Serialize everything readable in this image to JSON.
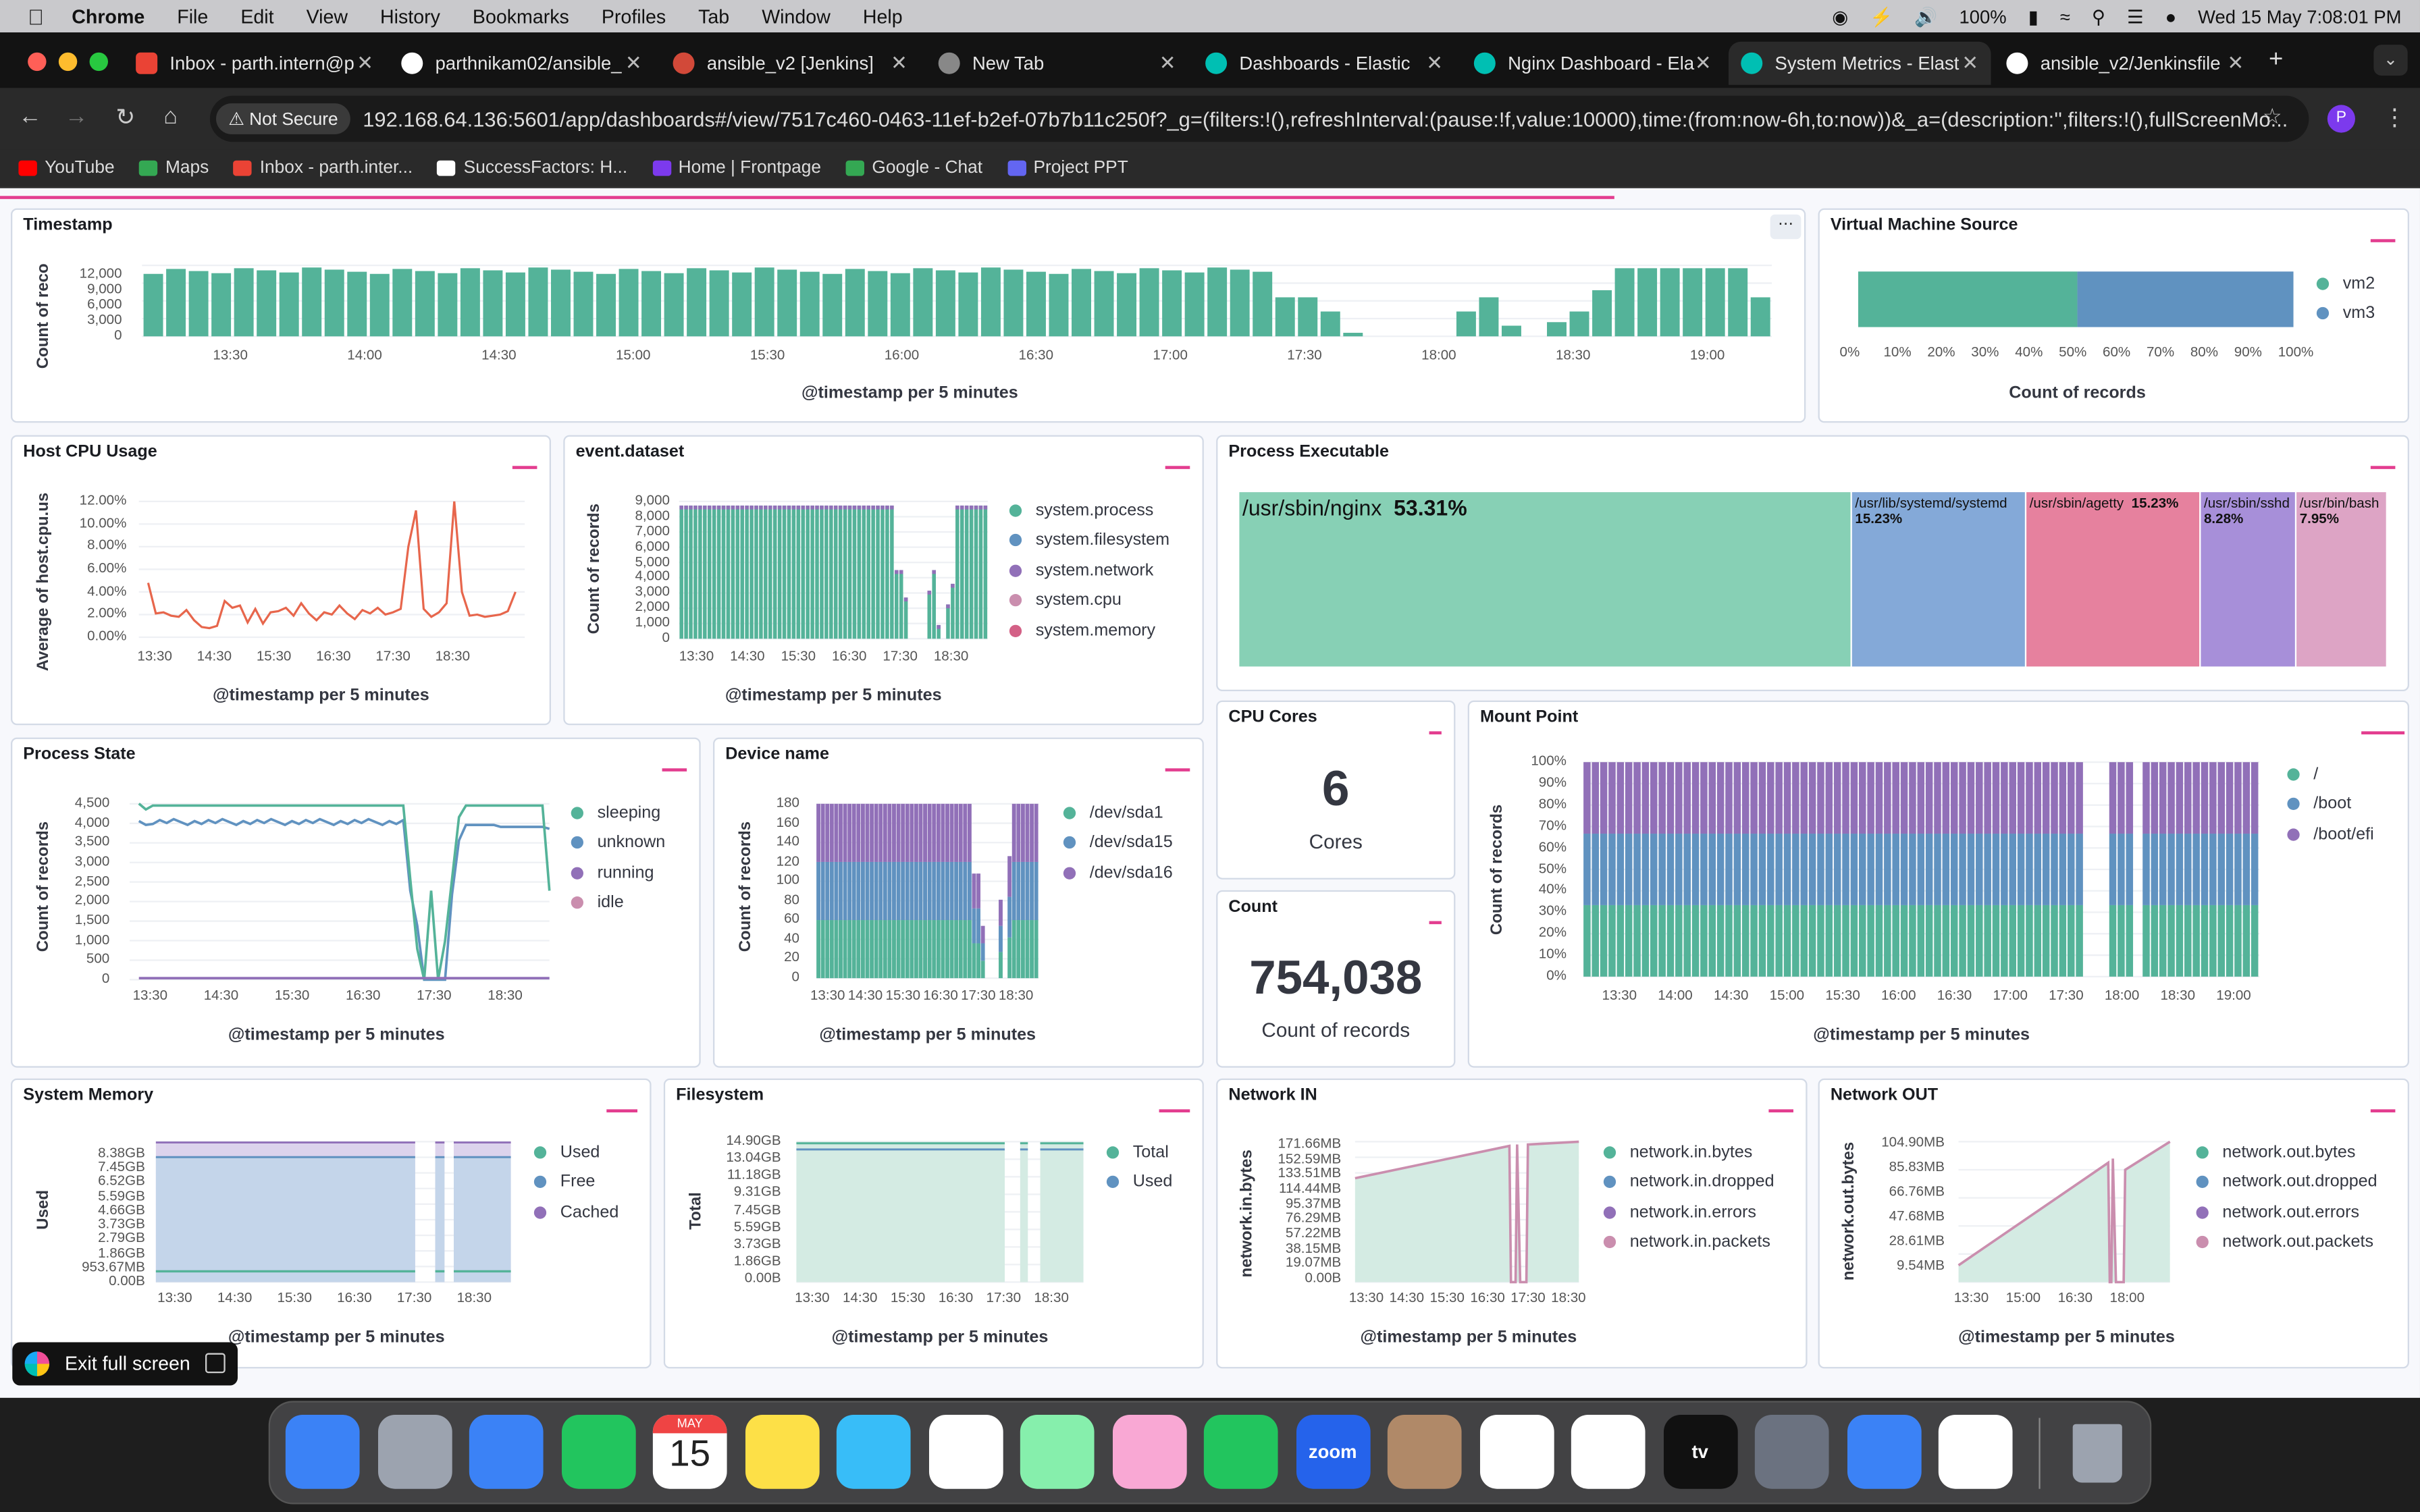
{
  "menubar": {
    "apple": "",
    "app": "Chrome",
    "items": [
      "File",
      "Edit",
      "View",
      "History",
      "Bookmarks",
      "Profiles",
      "Tab",
      "Window",
      "Help"
    ],
    "battery": "100%",
    "datetime": "Wed 15 May  7:08:01 PM"
  },
  "tabs": [
    {
      "title": "Inbox - parth.intern@p",
      "color": "#ea4335"
    },
    {
      "title": "parthnikam02/ansible_",
      "color": "#ffffff"
    },
    {
      "title": "ansible_v2 [Jenkins]",
      "color": "#d24939"
    },
    {
      "title": "New Tab",
      "color": "#888888"
    },
    {
      "title": "Dashboards - Elastic",
      "color": "#00bfb3"
    },
    {
      "title": "Nginx Dashboard - Ela",
      "color": "#00bfb3"
    },
    {
      "title": "System Metrics - Elast",
      "color": "#00bfb3"
    },
    {
      "title": "ansible_v2/Jenkinsfile",
      "color": "#ffffff"
    }
  ],
  "toolbar": {
    "not_secure": "Not Secure",
    "url": "192.168.64.136:5601/app/dashboards#/view/7517c460-0463-11ef-b2ef-07b7b11c250f?_g=(filters:!(),refreshInterval:(pause:!f,value:10000),time:(from:now-6h,to:now))&_a=(description:'',filters:!(),fullScreenMo...",
    "profile": "P"
  },
  "bookmarks": [
    {
      "label": "YouTube",
      "color": "#ff0000"
    },
    {
      "label": "Maps",
      "color": "#34a853"
    },
    {
      "label": "Inbox - parth.inter...",
      "color": "#ea4335"
    },
    {
      "label": "SuccessFactors: H...",
      "color": "#ffffff"
    },
    {
      "label": "Home | Frontpage",
      "color": "#7c3aed"
    },
    {
      "label": "Google - Chat",
      "color": "#34a853"
    },
    {
      "label": "Project PPT",
      "color": "#6366f1"
    }
  ],
  "panels": {
    "timestamp": {
      "title": "Timestamp",
      "ylabel": "Count of reco",
      "xlabel": "@timestamp per 5 minutes",
      "yticks": [
        "12,000",
        "9,000",
        "6,000",
        "3,000",
        "0"
      ],
      "xticks": [
        "13:30",
        "14:00",
        "14:30",
        "15:00",
        "15:30",
        "16:00",
        "16:30",
        "17:00",
        "17:30",
        "18:00",
        "18:30",
        "19:00"
      ]
    },
    "vm": {
      "title": "Virtual Machine Source",
      "xlabel": "Count of records",
      "xticks": [
        "0%",
        "10%",
        "20%",
        "30%",
        "40%",
        "50%",
        "60%",
        "70%",
        "80%",
        "90%",
        "100%"
      ],
      "legend": [
        "vm2",
        "vm3"
      ]
    },
    "cpu": {
      "title": "Host CPU Usage",
      "ylabel": "Average of host.cpu.us",
      "xlabel": "@timestamp per 5 minutes",
      "yticks": [
        "12.00%",
        "10.00%",
        "8.00%",
        "6.00%",
        "4.00%",
        "2.00%",
        "0.00%"
      ],
      "xticks": [
        "13:30",
        "14:30",
        "15:30",
        "16:30",
        "17:30",
        "18:30"
      ]
    },
    "dataset": {
      "title": "event.dataset",
      "ylabel": "Count of records",
      "xlabel": "@timestamp per 5 minutes",
      "yticks": [
        "9,000",
        "8,000",
        "7,000",
        "6,000",
        "5,000",
        "4,000",
        "3,000",
        "2,000",
        "1,000",
        "0"
      ],
      "xticks": [
        "13:30",
        "14:30",
        "15:30",
        "16:30",
        "17:30",
        "18:30"
      ],
      "legend": [
        "system.process",
        "system.filesystem",
        "system.network",
        "system.cpu",
        "system.memory"
      ]
    },
    "exec": {
      "title": "Process Executable",
      "cells": [
        {
          "label": "/usr/sbin/nginx",
          "pct": "53.31%"
        },
        {
          "label": "/usr/lib/systemd/systemd",
          "pct": "15.23%"
        },
        {
          "label": "/usr/sbin/agetty",
          "pct": "15.23%"
        },
        {
          "label": "/usr/sbin/sshd",
          "pct": "8.28%"
        },
        {
          "label": "/usr/bin/bash",
          "pct": "7.95%"
        }
      ]
    },
    "state": {
      "title": "Process State",
      "ylabel": "Count of records",
      "xlabel": "@timestamp per 5 minutes",
      "yticks": [
        "4,500",
        "4,000",
        "3,500",
        "3,000",
        "2,500",
        "2,000",
        "1,500",
        "1,000",
        "500",
        "0"
      ],
      "xticks": [
        "13:30",
        "14:30",
        "15:30",
        "16:30",
        "17:30",
        "18:30"
      ],
      "legend": [
        "sleeping",
        "unknown",
        "running",
        "idle"
      ]
    },
    "device": {
      "title": "Device name",
      "ylabel": "Count of records",
      "xlabel": "@timestamp per 5 minutes",
      "yticks": [
        "180",
        "160",
        "140",
        "120",
        "100",
        "80",
        "60",
        "40",
        "20",
        "0"
      ],
      "xticks": [
        "13:30",
        "14:30",
        "15:30",
        "16:30",
        "17:30",
        "18:30"
      ],
      "legend": [
        "/dev/sda1",
        "/dev/sda15",
        "/dev/sda16"
      ]
    },
    "cores": {
      "title": "CPU Cores",
      "value": "6",
      "label": "Cores"
    },
    "count": {
      "title": "Count",
      "value": "754,038",
      "label": "Count of records"
    },
    "mount": {
      "title": "Mount Point",
      "ylabel": "Count of records",
      "xlabel": "@timestamp per 5 minutes",
      "yticks": [
        "100%",
        "90%",
        "80%",
        "70%",
        "60%",
        "50%",
        "40%",
        "30%",
        "20%",
        "10%",
        "0%"
      ],
      "xticks": [
        "13:30",
        "14:00",
        "14:30",
        "15:00",
        "15:30",
        "16:00",
        "16:30",
        "17:00",
        "17:30",
        "18:00",
        "18:30",
        "19:00"
      ],
      "legend": [
        "/",
        "/boot",
        "/boot/efi"
      ]
    },
    "mem": {
      "title": "System Memory",
      "ylabel": "Used",
      "xlabel": "@timestamp per 5 minutes",
      "yticks": [
        "8.38GB",
        "7.45GB",
        "6.52GB",
        "5.59GB",
        "4.66GB",
        "3.73GB",
        "2.79GB",
        "1.86GB",
        "953.67MB",
        "0.00B"
      ],
      "xticks": [
        "13:30",
        "14:30",
        "15:30",
        "16:30",
        "17:30",
        "18:30"
      ],
      "legend": [
        "Used",
        "Free",
        "Cached"
      ]
    },
    "fsys": {
      "title": "Filesystem",
      "ylabel": "Total",
      "xlabel": "@timestamp per 5 minutes",
      "yticks": [
        "14.90GB",
        "13.04GB",
        "11.18GB",
        "9.31GB",
        "7.45GB",
        "5.59GB",
        "3.73GB",
        "1.86GB",
        "0.00B"
      ],
      "xticks": [
        "13:30",
        "14:30",
        "15:30",
        "16:30",
        "17:30",
        "18:30"
      ],
      "legend": [
        "Total",
        "Used"
      ]
    },
    "netin": {
      "title": "Network IN",
      "ylabel": "network.in.bytes",
      "xlabel": "@timestamp per 5 minutes",
      "yticks": [
        "171.66MB",
        "152.59MB",
        "133.51MB",
        "114.44MB",
        "95.37MB",
        "76.29MB",
        "57.22MB",
        "38.15MB",
        "19.07MB",
        "0.00B"
      ],
      "xticks": [
        "13:30",
        "14:30",
        "15:30",
        "16:30",
        "17:30",
        "18:30"
      ],
      "legend": [
        "network.in.bytes",
        "network.in.dropped",
        "network.in.errors",
        "network.in.packets"
      ]
    },
    "netout": {
      "title": "Network OUT",
      "ylabel": "network.out.bytes",
      "xlabel": "@timestamp per 5 minutes",
      "yticks": [
        "104.90MB",
        "85.83MB",
        "66.76MB",
        "47.68MB",
        "28.61MB",
        "9.54MB"
      ],
      "xticks": [
        "13:30",
        "15:00",
        "16:30",
        "18:00"
      ],
      "legend": [
        "network.out.bytes",
        "network.out.dropped",
        "network.out.errors",
        "network.out.packets"
      ]
    }
  },
  "exit_fullscreen": "Exit full screen",
  "dock": [
    {
      "name": "finder",
      "color": "#3b82f6"
    },
    {
      "name": "launchpad",
      "color": "#9ca3af"
    },
    {
      "name": "mail",
      "color": "#3b82f6"
    },
    {
      "name": "messages",
      "color": "#22c55e"
    },
    {
      "name": "calendar",
      "color": "#ffffff",
      "month": "MAY",
      "day": "15"
    },
    {
      "name": "notes",
      "color": "#fde047"
    },
    {
      "name": "safari",
      "color": "#38bdf8"
    },
    {
      "name": "chrome",
      "color": "#ffffff"
    },
    {
      "name": "maps",
      "color": "#86efac"
    },
    {
      "name": "photos",
      "color": "#f9a8d4"
    },
    {
      "name": "facetime",
      "color": "#22c55e"
    },
    {
      "name": "zoom",
      "color": "#2563eb",
      "label": "zoom"
    },
    {
      "name": "contacts",
      "color": "#b08968"
    },
    {
      "name": "reminders",
      "color": "#ffffff"
    },
    {
      "name": "freeform",
      "color": "#ffffff"
    },
    {
      "name": "tv",
      "color": "#111111",
      "label": "tv"
    },
    {
      "name": "system-settings",
      "color": "#6b7280"
    },
    {
      "name": "app-store",
      "color": "#3b82f6"
    },
    {
      "name": "vscode",
      "color": "#ffffff"
    },
    {
      "name": "trash",
      "color": "#9ca3af"
    }
  ]
}
